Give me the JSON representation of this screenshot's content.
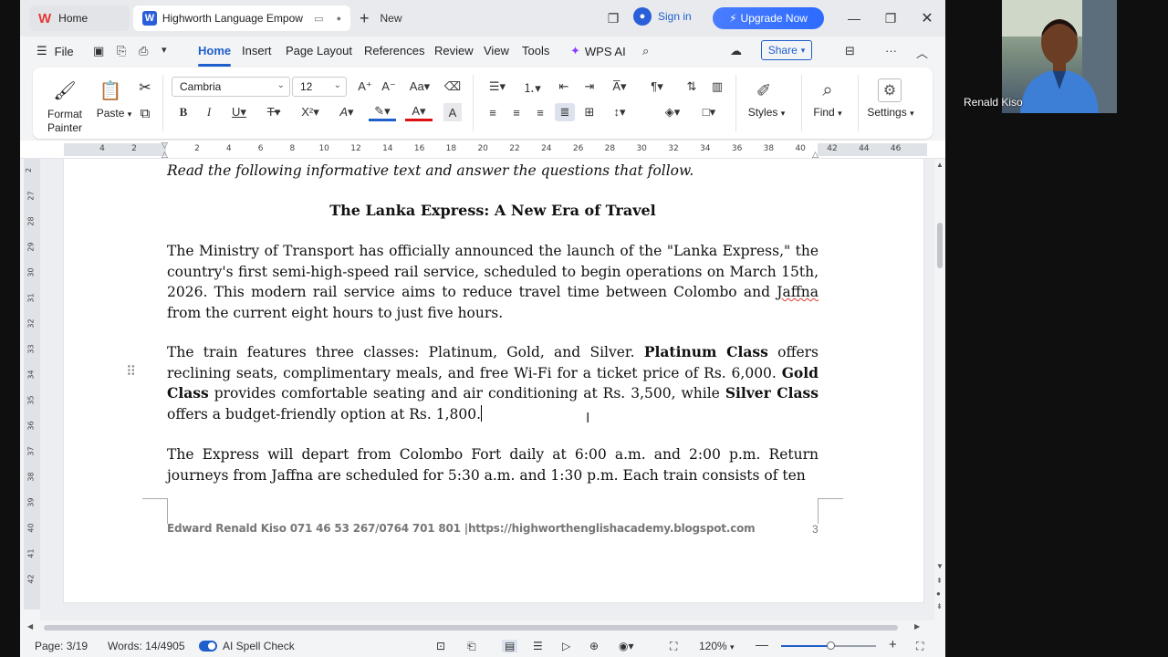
{
  "tabs": {
    "home": "Home",
    "document": "Highworth Language Empow",
    "new": "New"
  },
  "account": {
    "signin": "Sign in",
    "upgrade": "Upgrade Now"
  },
  "menu": {
    "file": "File",
    "items": [
      "Home",
      "Insert",
      "Page Layout",
      "References",
      "Review",
      "View",
      "Tools",
      "WPS AI"
    ],
    "share": "Share"
  },
  "ribbon": {
    "format_painter": "Format Painter",
    "format_painter_l1": "Format",
    "format_painter_l2": "Painter",
    "paste": "Paste",
    "font_name": "Cambria",
    "font_size": "12",
    "styles": "Styles",
    "find": "Find",
    "settings": "Settings"
  },
  "ruler": {
    "left_numbers": [
      "4",
      "2"
    ],
    "numbers": [
      "2",
      "4",
      "6",
      "8",
      "10",
      "12",
      "14",
      "16",
      "18",
      "20",
      "22",
      "24",
      "26",
      "28",
      "30",
      "32",
      "34",
      "36",
      "38",
      "40",
      "42",
      "44",
      "46"
    ],
    "vertical_numbers": [
      "2",
      "27",
      "28",
      "29",
      "30",
      "31",
      "32",
      "33",
      "34",
      "35",
      "36",
      "37",
      "38",
      "39",
      "40",
      "41",
      "42"
    ]
  },
  "document": {
    "instruction": "Read the following informative text and answer the questions that follow.",
    "heading": "The Lanka Express: A New Era of Travel",
    "para1_a": "The Ministry of Transport has officially announced the launch of the \"Lanka Express,\" the country's first semi-high-speed rail service, scheduled to begin operations on March 15th, 2026. This modern rail service aims to reduce travel time between Colombo and ",
    "para1_misspelled": "Jaffna",
    "para1_b": " from the current eight hours to just five hours.",
    "para2_a": "The train features three classes: Platinum, Gold, and Silver. ",
    "para2_b1": "Platinum Class",
    "para2_c": " offers reclining seats, complimentary meals, and free Wi-Fi for a ticket price of Rs. 6,000. ",
    "para2_b2": "Gold Class",
    "para2_d": " provides comfortable seating and air conditioning at Rs. 3,500, while ",
    "para2_b3": "Silver Class",
    "para2_e": " offers a budget-friendly option at Rs. 1,800.",
    "para3": "The Express will depart from Colombo Fort daily at 6:00 a.m. and 2:00 p.m. Return journeys from Jaffna are scheduled for 5:30 a.m. and 1:30 p.m. Each train consists of ten",
    "footer": "Edward Renald Kiso 071 46 53 267/0764 701 801 |https://highworthenglishacademy.blogspot.com",
    "page_number": "3"
  },
  "status": {
    "page": "Page: 3/19",
    "words": "Words: 14/4905",
    "spell_check": "AI Spell Check",
    "zoom": "120%",
    "zoom_fraction": 0.52
  },
  "webcam": {
    "name": "Renald Kiso"
  },
  "colors": {
    "accent": "#1f5fcc",
    "upgrade": "#2d6bff",
    "spell_error": "#e53935"
  }
}
